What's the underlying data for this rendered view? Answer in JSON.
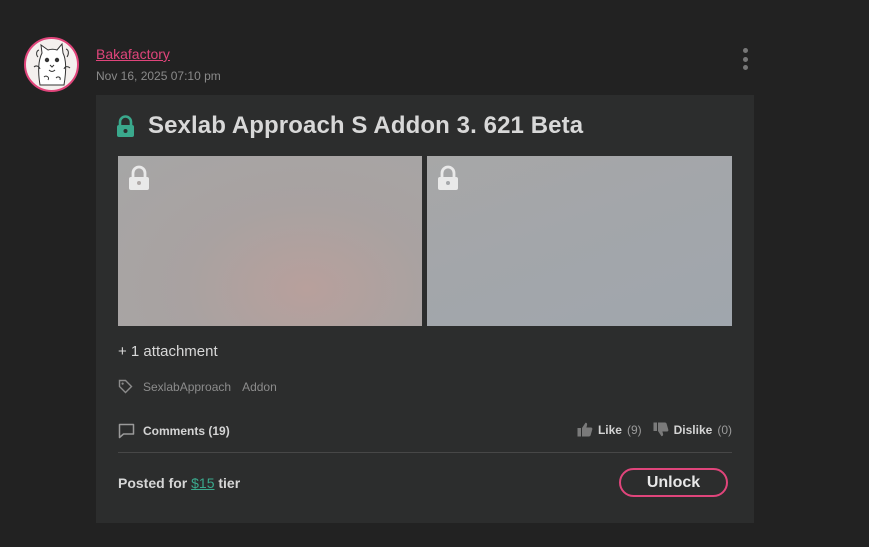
{
  "post": {
    "author": "Bakafactory",
    "date": "Nov 16, 2025 07:10 pm",
    "title": "Sexlab Approach S Addon 3. 621 Beta",
    "attachments_label": "+ 1 attachment",
    "tags": [
      "SexlabApproach",
      "Addon"
    ],
    "comments_label": "Comments (19)",
    "like_label": "Like",
    "like_count": "(9)",
    "dislike_label": "Dislike",
    "dislike_count": "(0)",
    "posted_prefix": "Posted for ",
    "tier_price": "$15",
    "posted_suffix": " tier",
    "unlock_label": "Unlock"
  },
  "colors": {
    "accent": "#e0457b",
    "lock_green": "#3aa88c",
    "background": "#222222",
    "card": "#2c2d2d"
  },
  "icons": [
    "avatar",
    "kebab-menu-icon",
    "lock-icon",
    "tag-icon",
    "comment-icon",
    "thumbs-up-icon",
    "thumbs-down-icon"
  ]
}
